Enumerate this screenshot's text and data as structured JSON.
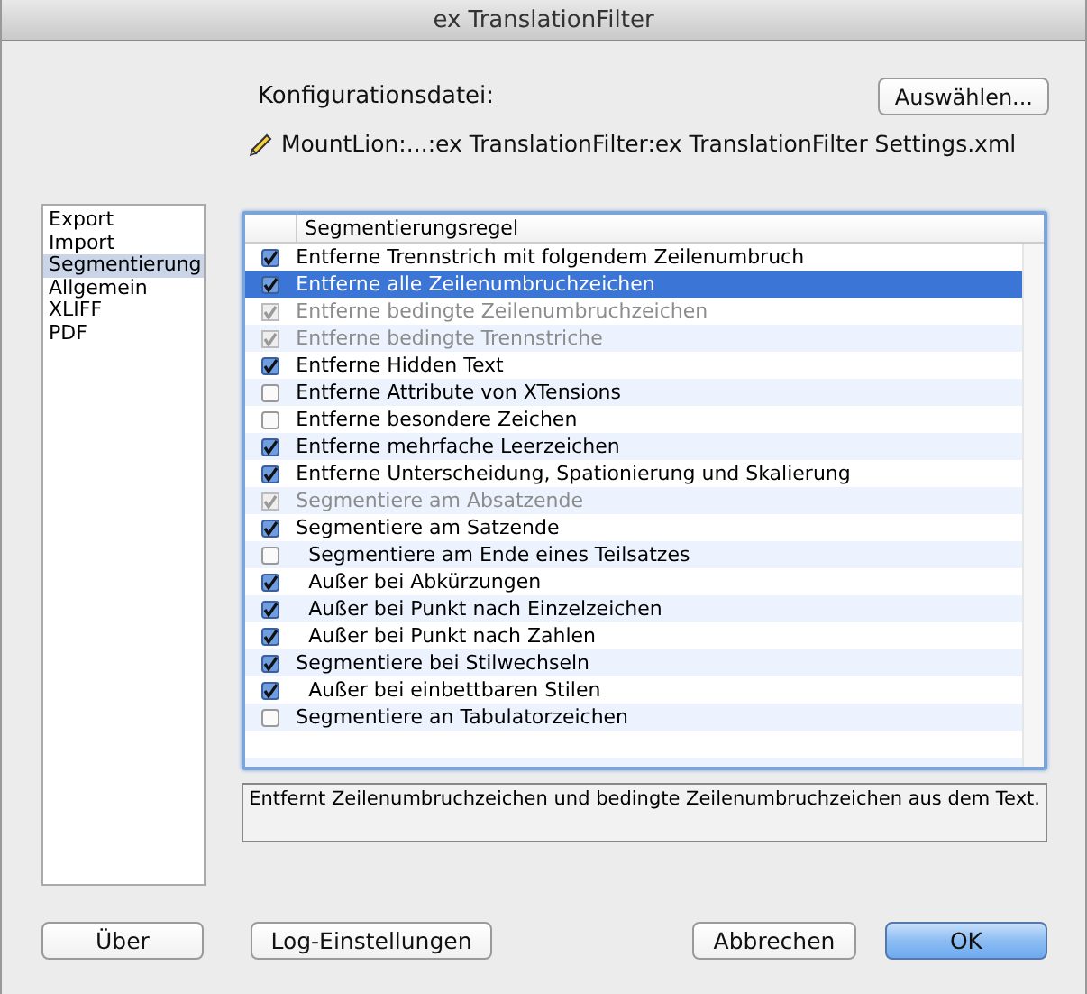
{
  "window": {
    "title": "ex TranslationFilter"
  },
  "config": {
    "label": "Konfigurationsdatei:",
    "choose_button": "Auswählen...",
    "path": "MountLion:...:ex TranslationFilter:ex TranslationFilter Settings.xml"
  },
  "sidebar": {
    "items": [
      {
        "label": "Export",
        "selected": false
      },
      {
        "label": "Import",
        "selected": false
      },
      {
        "label": "Segmentierung",
        "selected": true
      },
      {
        "label": "Allgemein",
        "selected": false
      },
      {
        "label": "XLIFF",
        "selected": false
      },
      {
        "label": "PDF",
        "selected": false
      }
    ]
  },
  "table": {
    "columns": [
      "Segmentierungsregel"
    ],
    "rows": [
      {
        "label": "Entferne Trennstrich mit folgendem Zeilenumbruch",
        "checked": true,
        "disabled": false,
        "selected": false
      },
      {
        "label": "Entferne alle Zeilenumbruchzeichen",
        "checked": true,
        "disabled": false,
        "selected": true
      },
      {
        "label": "Entferne bedingte Zeilenumbruchzeichen",
        "checked": true,
        "disabled": true,
        "selected": false
      },
      {
        "label": "Entferne bedingte Trennstriche",
        "checked": true,
        "disabled": true,
        "selected": false
      },
      {
        "label": "Entferne Hidden Text",
        "checked": true,
        "disabled": false,
        "selected": false
      },
      {
        "label": "Entferne Attribute von XTensions",
        "checked": false,
        "disabled": false,
        "selected": false
      },
      {
        "label": "Entferne besondere Zeichen",
        "checked": false,
        "disabled": false,
        "selected": false
      },
      {
        "label": "Entferne mehrfache Leerzeichen",
        "checked": true,
        "disabled": false,
        "selected": false
      },
      {
        "label": "Entferne Unterscheidung, Spationierung und Skalierung",
        "checked": true,
        "disabled": false,
        "selected": false
      },
      {
        "label": "Segmentiere am Absatzende",
        "checked": true,
        "disabled": true,
        "selected": false
      },
      {
        "label": "Segmentiere am Satzende",
        "checked": true,
        "disabled": false,
        "selected": false,
        "children": [
          {
            "label": "Segmentiere am Ende eines Teilsatzes",
            "checked": false,
            "disabled": false,
            "selected": false
          },
          {
            "label": "Außer bei Abkürzungen",
            "checked": true,
            "disabled": false,
            "selected": false
          },
          {
            "label": "Außer bei Punkt nach Einzelzeichen",
            "checked": true,
            "disabled": false,
            "selected": false
          },
          {
            "label": "Außer bei Punkt nach Zahlen",
            "checked": true,
            "disabled": false,
            "selected": false
          }
        ]
      },
      {
        "label": "Segmentiere bei Stilwechseln",
        "checked": true,
        "disabled": false,
        "selected": false,
        "children": [
          {
            "label": "Außer bei einbettbaren Stilen",
            "checked": true,
            "disabled": false,
            "selected": false
          }
        ]
      },
      {
        "label": "Segmentiere an Tabulatorzeichen",
        "checked": false,
        "disabled": false,
        "selected": false
      }
    ]
  },
  "description": "Entfernt Zeilenumbruchzeichen und bedingte Zeilenumbruchzeichen aus dem Text.",
  "buttons": [
    {
      "label": "Über",
      "kind": "normal"
    },
    {
      "label": "Log-Einstellungen",
      "kind": "normal"
    },
    {
      "label": "Abbrechen",
      "kind": "normal"
    },
    {
      "label": "OK",
      "kind": "default"
    }
  ]
}
